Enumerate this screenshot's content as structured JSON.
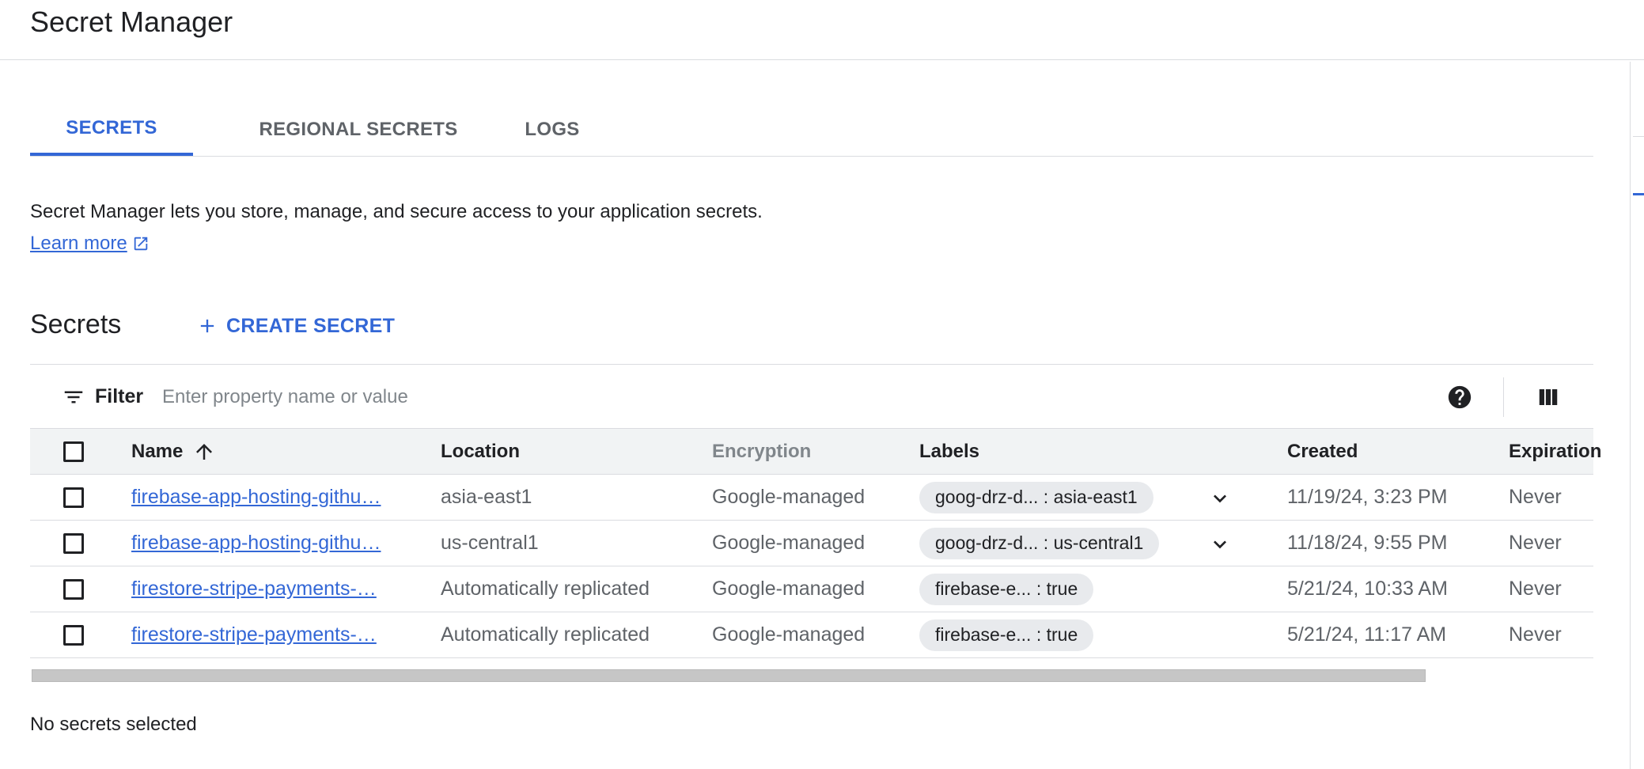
{
  "header": {
    "title": "Secret Manager"
  },
  "tabs": [
    {
      "label": "SECRETS",
      "active": true
    },
    {
      "label": "REGIONAL SECRETS",
      "active": false
    },
    {
      "label": "LOGS",
      "active": false
    }
  ],
  "intro": {
    "description": "Secret Manager lets you store, manage, and secure access to your application secrets.",
    "learn_more": "Learn more",
    "learn_more_icon": "open-in-new-icon"
  },
  "section": {
    "title": "Secrets",
    "create_label": "CREATE SECRET",
    "create_icon": "plus-icon"
  },
  "filter": {
    "label": "Filter",
    "placeholder": "Enter property name or value",
    "icons": [
      "filter-icon",
      "help-icon",
      "columns-icon"
    ]
  },
  "table": {
    "columns": {
      "name": "Name",
      "location": "Location",
      "encryption": "Encryption",
      "labels": "Labels",
      "created": "Created",
      "expiration": "Expiration"
    },
    "sort": {
      "column": "Name",
      "direction": "ascending",
      "icon": "arrow-up-icon"
    },
    "rows": [
      {
        "name": "firebase-app-hosting-githu…",
        "location": "asia-east1",
        "encryption": "Google-managed",
        "label": "goog-drz-d... : asia-east1",
        "has_expand": true,
        "created": "11/19/24, 3:23 PM",
        "expiration": "Never"
      },
      {
        "name": "firebase-app-hosting-githu…",
        "location": "us-central1",
        "encryption": "Google-managed",
        "label": "goog-drz-d... : us-central1",
        "has_expand": true,
        "created": "11/18/24, 9:55 PM",
        "expiration": "Never"
      },
      {
        "name": "firestore-stripe-payments-…",
        "location": "Automatically replicated",
        "encryption": "Google-managed",
        "label": "firebase-e... : true",
        "has_expand": false,
        "created": "5/21/24, 10:33 AM",
        "expiration": "Never"
      },
      {
        "name": "firestore-stripe-payments-…",
        "location": "Automatically replicated",
        "encryption": "Google-managed",
        "label": "firebase-e... : true",
        "has_expand": false,
        "created": "5/21/24, 11:17 AM",
        "expiration": "Never"
      }
    ]
  },
  "selection_status": "No secrets selected",
  "colors": {
    "accent": "#3367d6",
    "text": "#202124",
    "muted": "#5f6368",
    "border": "#dadce0",
    "chip": "#e8eaed"
  }
}
